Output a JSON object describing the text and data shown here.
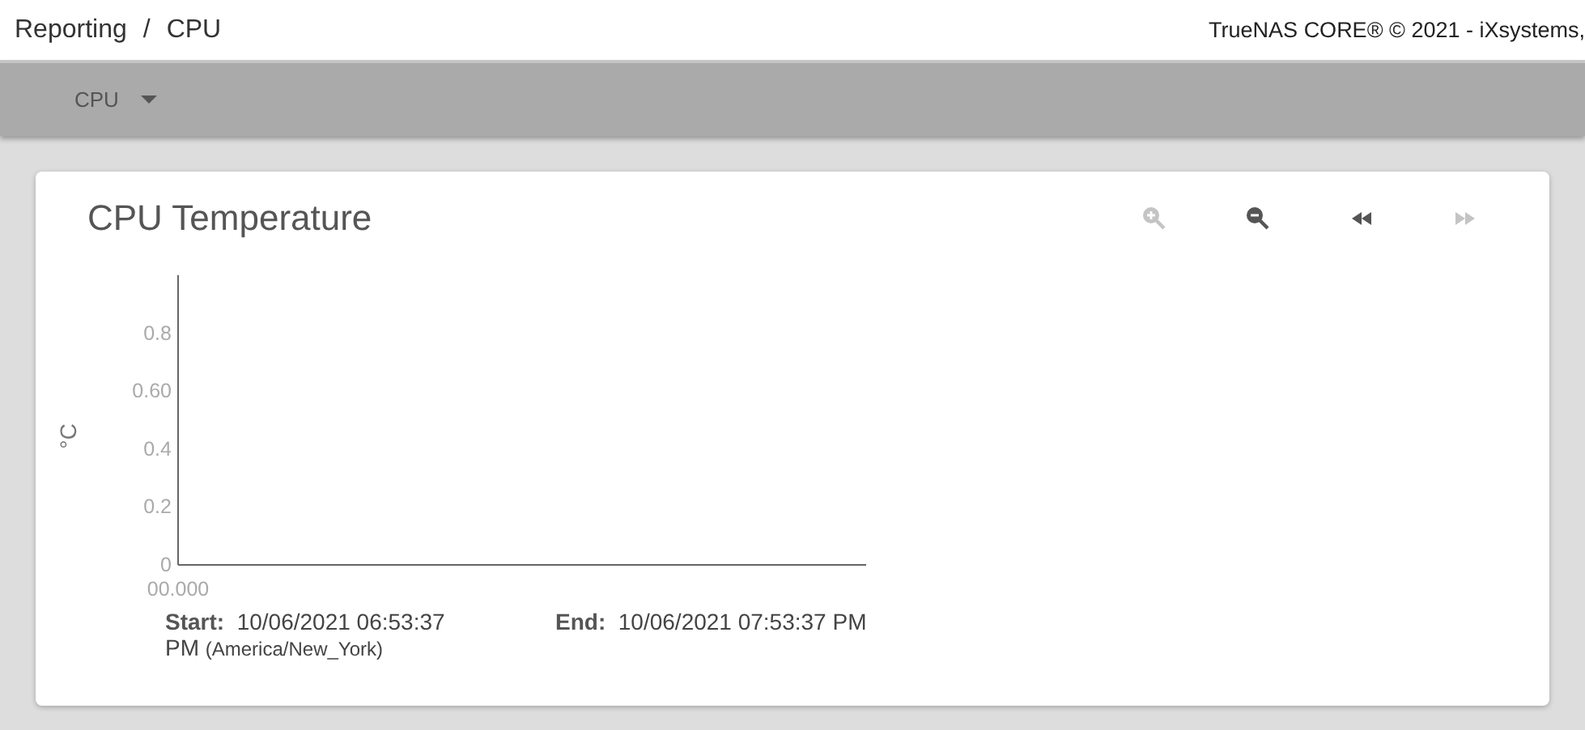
{
  "breadcrumb": {
    "items": [
      "Reporting",
      "CPU"
    ],
    "separator": "/"
  },
  "copyright": "TrueNAS CORE® © 2021 - iXsystems,",
  "toolbar": {
    "menu": {
      "label": "CPU"
    }
  },
  "card": {
    "title": "CPU Temperature",
    "controls": [
      {
        "kind": "zoom-in",
        "disabled": true
      },
      {
        "kind": "zoom-out",
        "disabled": false
      },
      {
        "kind": "back",
        "disabled": false
      },
      {
        "kind": "forward",
        "disabled": true
      }
    ],
    "chart": {
      "y_axis_label": "°C",
      "y_tick_labels": [
        "0.8",
        "0.60",
        "0.4",
        "0.2",
        "0"
      ],
      "x_tick_label": "00.000"
    },
    "legend": {
      "start_label": "Start:",
      "start_value": "10/06/2021 06:53:37 PM",
      "timezone": "(America/New_York)",
      "end_label": "End:",
      "end_value": "10/06/2021 07:53:37 PM"
    }
  }
}
